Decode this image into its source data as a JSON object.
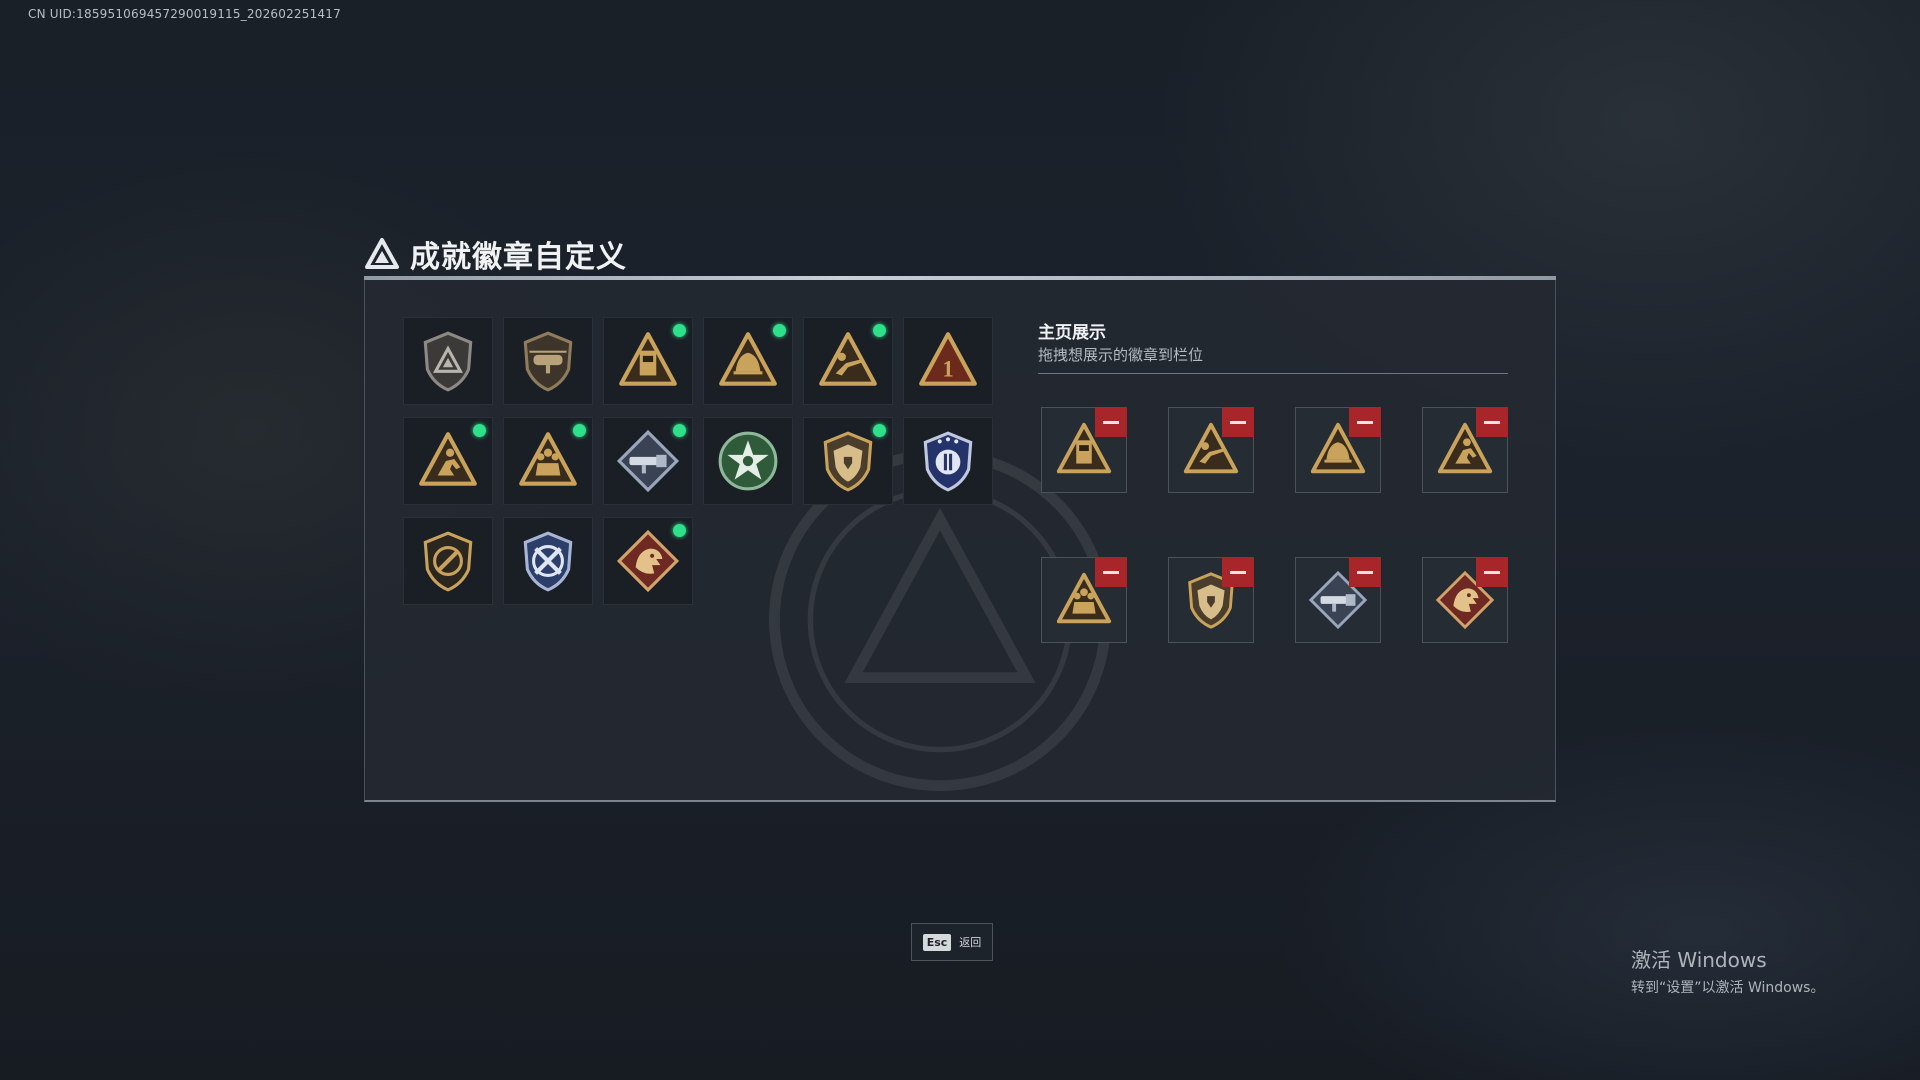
{
  "uid_text": "CN UID:185951069457290019115_202602251417",
  "title": "成就徽章自定义",
  "showcase": {
    "title": "主页展示",
    "subtitle": "拖拽想展示的徽章到栏位"
  },
  "badges": [
    {
      "icon": "shield-triangle-badge-icon",
      "new": false
    },
    {
      "icon": "helicopter-shield-badge-icon",
      "new": false
    },
    {
      "icon": "crate-triangle-badge-icon",
      "new": true
    },
    {
      "icon": "helmet-triangle-badge-icon",
      "new": true
    },
    {
      "icon": "soldier-rifle-triangle-badge-icon",
      "new": true
    },
    {
      "icon": "number-one-triangle-badge-icon",
      "new": false
    },
    {
      "icon": "runner-triangle-badge-icon",
      "new": true
    },
    {
      "icon": "squad-triangle-badge-icon",
      "new": true
    },
    {
      "icon": "launcher-diamond-badge-icon",
      "new": true
    },
    {
      "icon": "green-star-badge-icon",
      "new": false
    },
    {
      "icon": "medic-shield-badge-icon",
      "new": true
    },
    {
      "icon": "blue-police-badge-icon",
      "new": false
    },
    {
      "icon": "crossed-rifle-shield-badge-icon",
      "new": false
    },
    {
      "icon": "blue-crossed-shield-badge-icon",
      "new": false
    },
    {
      "icon": "dragon-diamond-badge-icon",
      "new": true
    }
  ],
  "slots": [
    {
      "icon": "crate-triangle-badge-icon"
    },
    {
      "icon": "soldier-rifle-triangle-badge-icon"
    },
    {
      "icon": "helmet-triangle-badge-icon"
    },
    {
      "icon": "runner-triangle-badge-icon"
    },
    {
      "icon": "squad-triangle-badge-icon"
    },
    {
      "icon": "medic-shield-badge-icon"
    },
    {
      "icon": "launcher-diamond-badge-icon"
    },
    {
      "icon": "dragon-diamond-badge-icon"
    }
  ],
  "esc": {
    "key": "Esc",
    "label": "返回"
  },
  "windows_activation": {
    "title": "激活 Windows",
    "subtitle": "转到“设置”以激活 Windows。"
  },
  "colors": {
    "new_indicator": "#2ee08a",
    "remove_button": "#a8262a",
    "badge_gold": "#c9a35c"
  }
}
